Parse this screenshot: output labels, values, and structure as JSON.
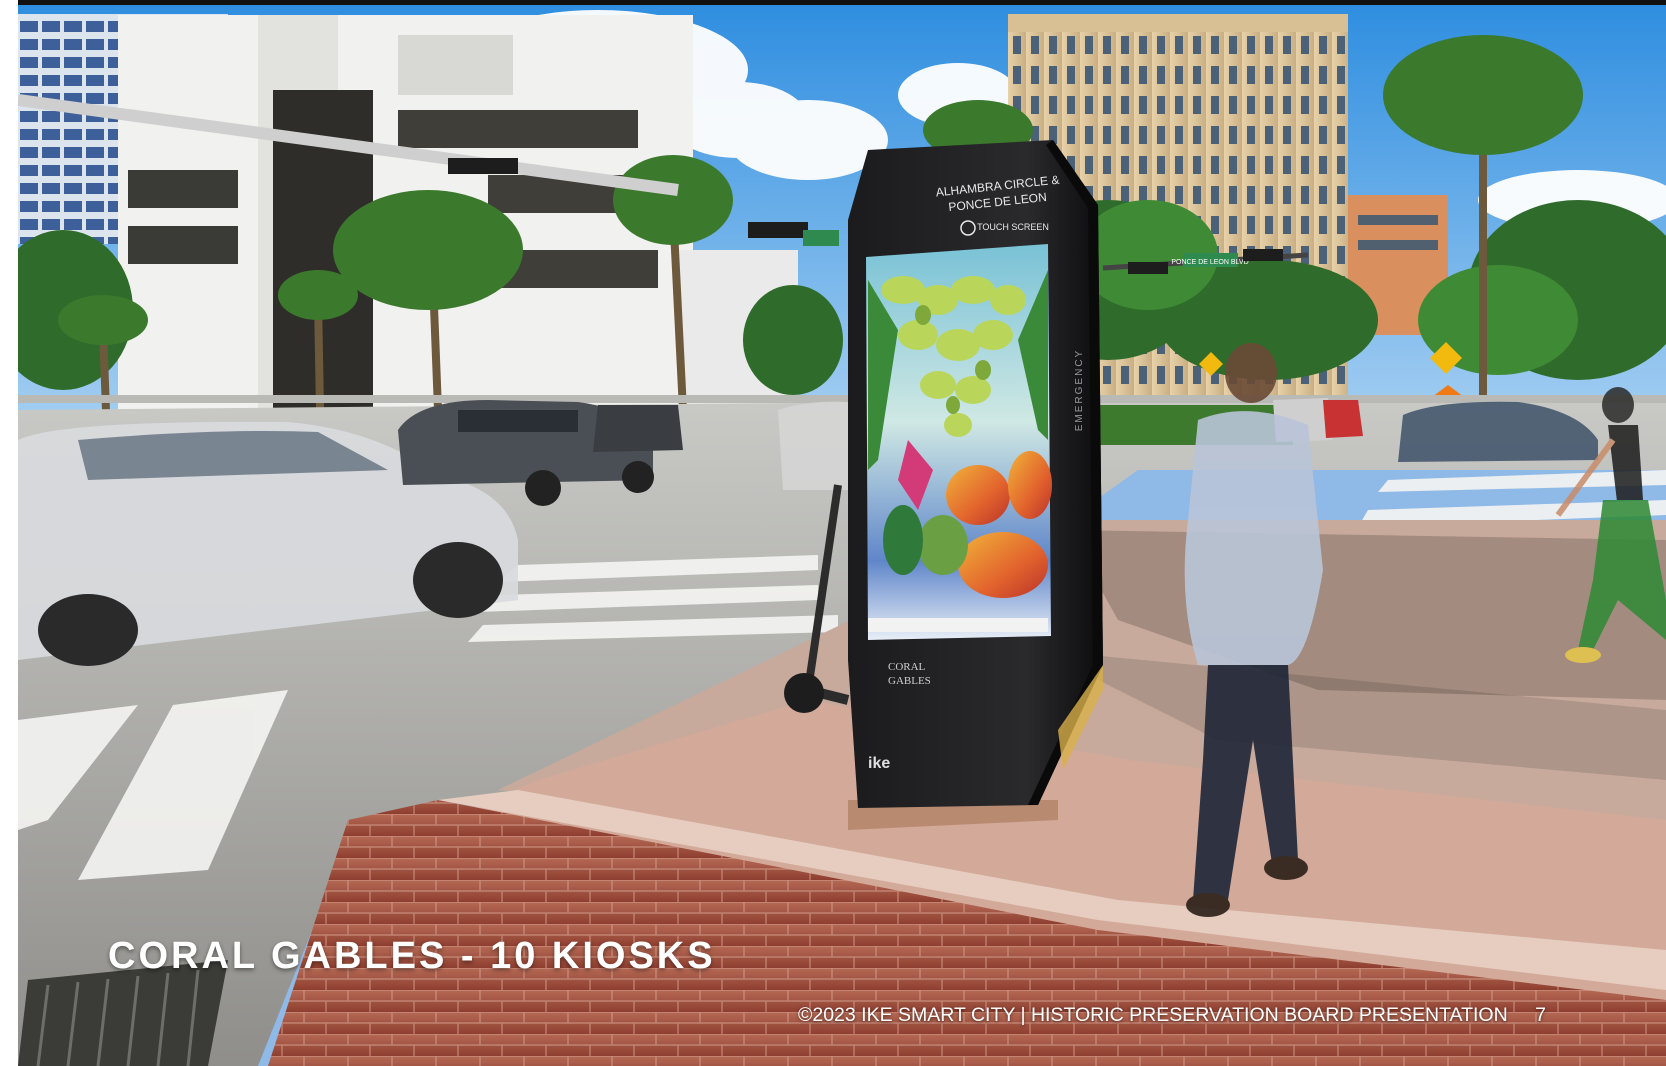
{
  "slide": {
    "title": "CORAL GABLES - 10 KIOSKS",
    "footer": "©2023 IKE SMART CITY | HISTORIC PRESERVATION BOARD PRESENTATION",
    "page_number": "7"
  },
  "photo": {
    "kiosk_location_line1": "ALHAMBRA CIRCLE &",
    "kiosk_location_line2": "PONCE DE LEON",
    "kiosk_touch_label": "TOUCH SCREEN",
    "kiosk_side_label": "EMERGENCY",
    "kiosk_brand": "ike",
    "kiosk_city_logo_line1": "CORAL",
    "kiosk_city_logo_line2": "GABLES",
    "street_sign_text": "PONCE DE LEON BLVD"
  }
}
